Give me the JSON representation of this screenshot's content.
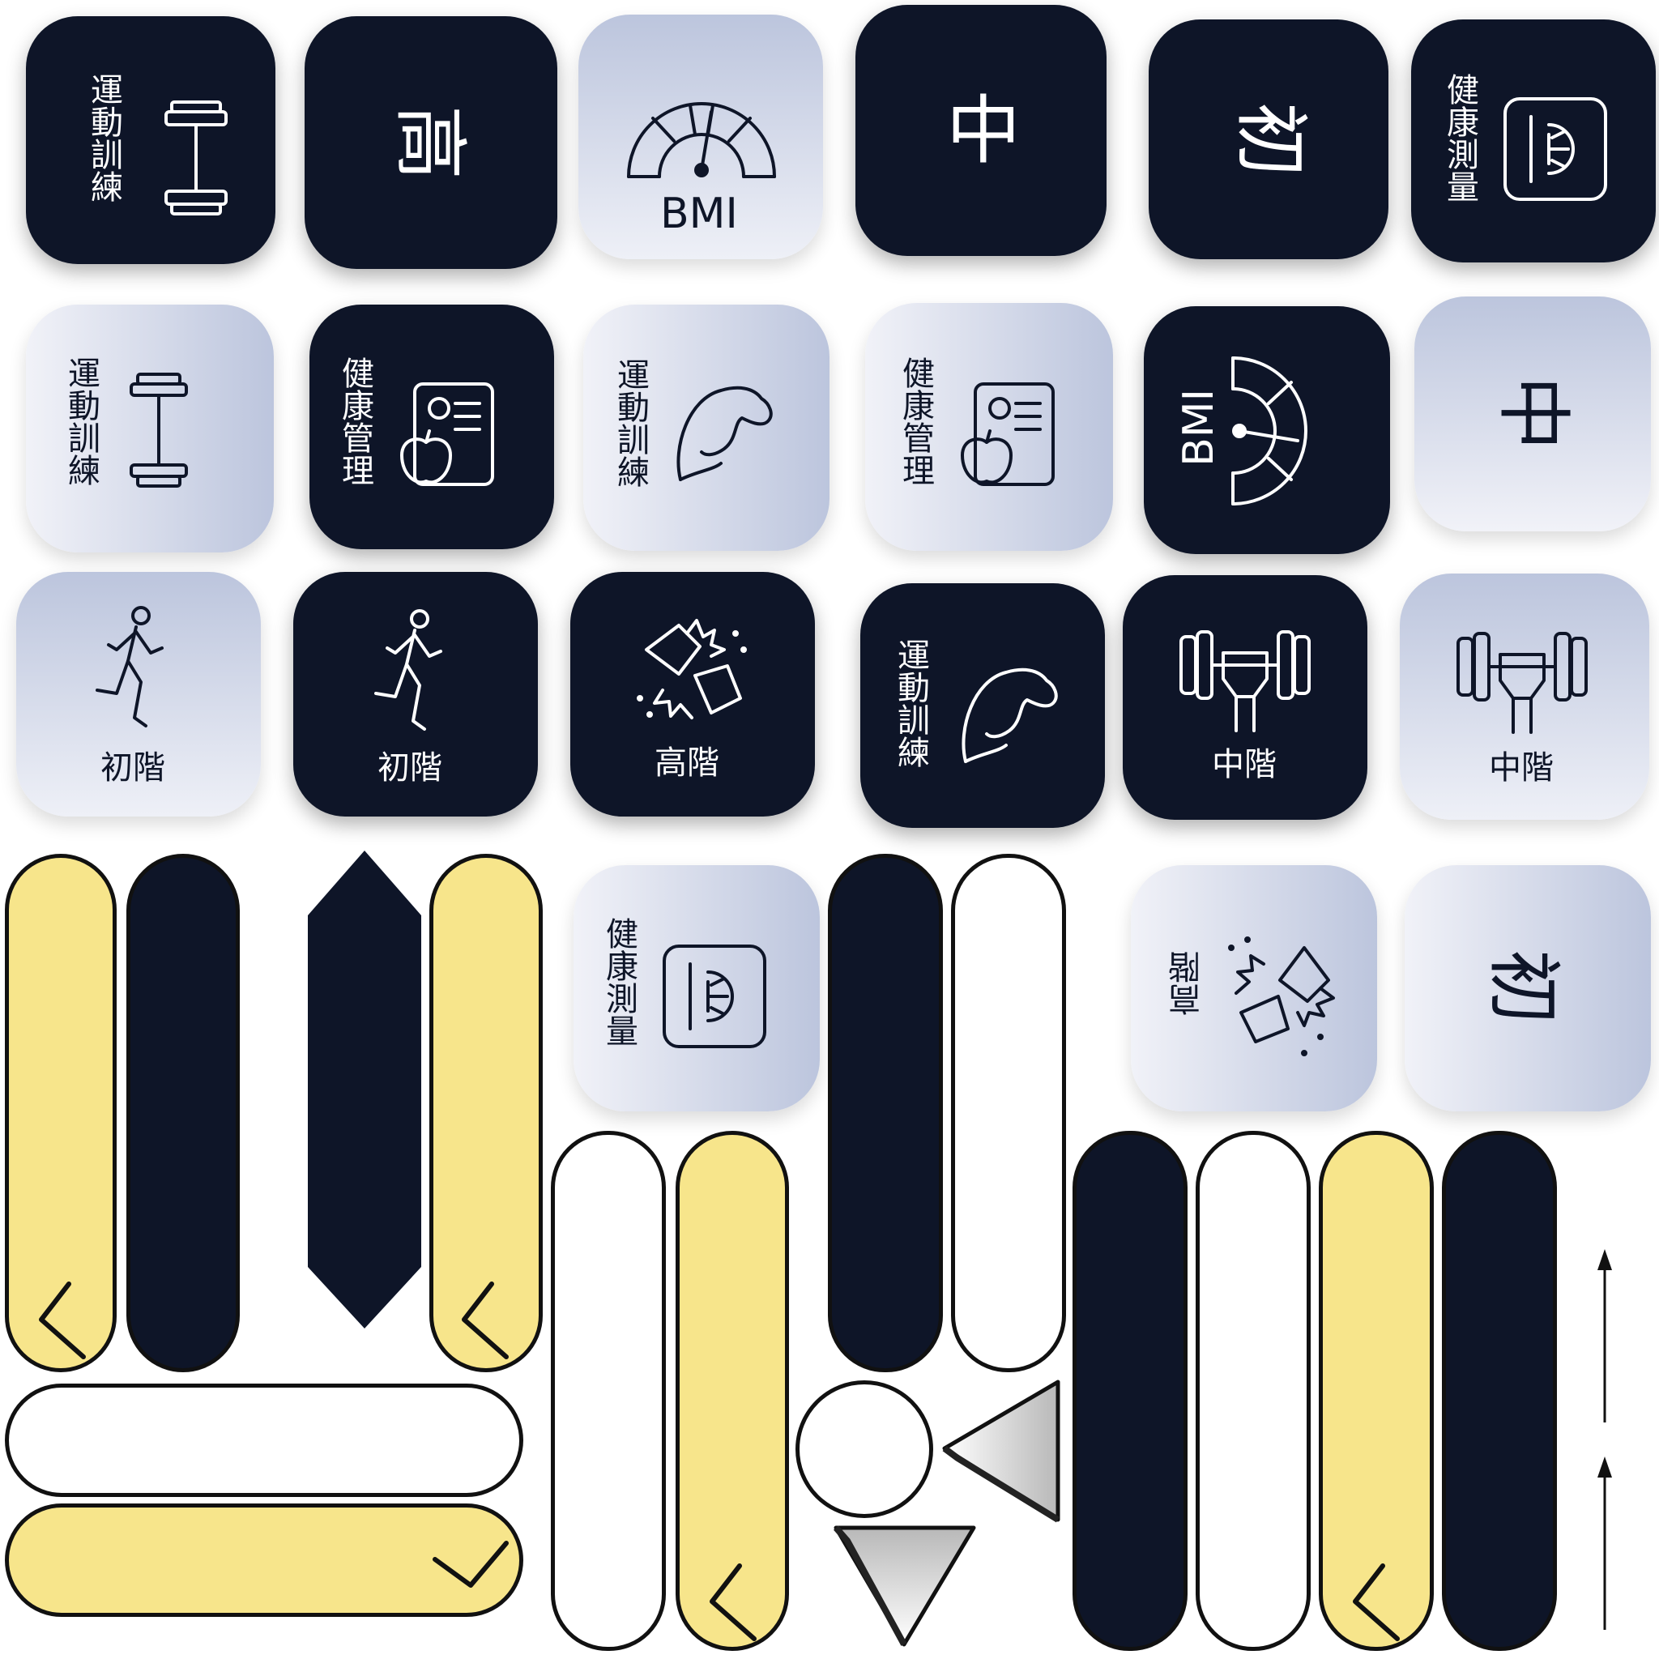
{
  "labels": {
    "exercise": "運動訓練",
    "measure": "健康測量",
    "manage": "健康管理",
    "bmi": "BMI",
    "beginner": "初階",
    "intermediate": "中階",
    "advanced": "高階",
    "beginner_char": "初",
    "intermediate_char": "中",
    "advanced_char": "高"
  },
  "colors": {
    "navy": "#0e1528",
    "pale_blue": "#bcc5dd",
    "yellow": "#f7e58b",
    "white": "#ffffff",
    "outline": "#111111"
  },
  "icons": [
    "dumbbell-icon",
    "scale-icon",
    "speedometer-icon",
    "clipboard-apple-icon",
    "flexed-arm-icon",
    "runner-icon",
    "boxing-gloves-icon",
    "fist-dumbbell-icon",
    "chevron-left-icon",
    "chevron-down-icon",
    "arrow-up-icon",
    "triangle-icon",
    "hexagon-shape"
  ]
}
